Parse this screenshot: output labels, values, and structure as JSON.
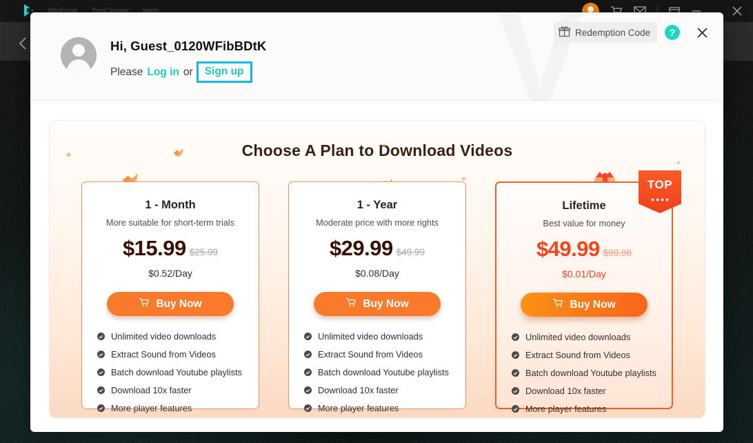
{
  "background_app": {
    "logo_icon": "play-logo-icon",
    "menu_items": [
      "iMyFone",
      "TopClipper",
      "Help"
    ],
    "titlebar_icons": [
      "user-avatar-icon",
      "cart-icon",
      "mail-icon",
      "restore-icon",
      "minimize-icon",
      "close-icon"
    ],
    "back_icon": "back-chevron-icon",
    "watermark": "V"
  },
  "modal": {
    "watermark": "V",
    "redemption": {
      "label": "Redemption Code",
      "icon": "gift-icon"
    },
    "help": {
      "label": "?",
      "icon": "help-icon"
    },
    "close": {
      "label": "✕",
      "icon": "close-icon"
    },
    "user": {
      "avatar_icon": "user-avatar-icon",
      "greeting": "Hi, Guest_0120WFibBDtK",
      "please_text": "Please",
      "login_label": "Log in",
      "or_text": "or",
      "signup_label": "Sign up",
      "highlight_color": "#12b5e8"
    }
  },
  "plans_panel": {
    "title": "Choose A Plan to Download Videos",
    "accent_color": "#f4601e",
    "top_badge": "TOP",
    "cards": [
      {
        "name": "1 - Month",
        "desc": "More suitable for short-term trials",
        "price": "$15.99",
        "old_price": "$25.99",
        "per_day": "$0.52/Day",
        "buy_label": "Buy Now",
        "cart_icon": "cart-icon",
        "featured": false,
        "features": [
          "Unlimited video downloads",
          "Extract Sound from Videos",
          "Batch download Youtube playlists",
          "Download 10x faster",
          "More player features"
        ]
      },
      {
        "name": "1 - Year",
        "desc": "Moderate price with more rights",
        "price": "$29.99",
        "old_price": "$49.99",
        "per_day": "$0.08/Day",
        "buy_label": "Buy Now",
        "cart_icon": "cart-icon",
        "featured": false,
        "features": [
          "Unlimited video downloads",
          "Extract Sound from Videos",
          "Batch download Youtube playlists",
          "Download 10x faster",
          "More player features"
        ]
      },
      {
        "name": "Lifetime",
        "desc": "Best value for money",
        "price": "$49.99",
        "old_price": "$99.98",
        "per_day": "$0.01/Day",
        "buy_label": "Buy Now",
        "cart_icon": "cart-icon",
        "featured": true,
        "features": [
          "Unlimited video downloads",
          "Extract Sound from Videos",
          "Batch download Youtube playlists",
          "Download 10x faster",
          "More player features"
        ]
      }
    ]
  }
}
